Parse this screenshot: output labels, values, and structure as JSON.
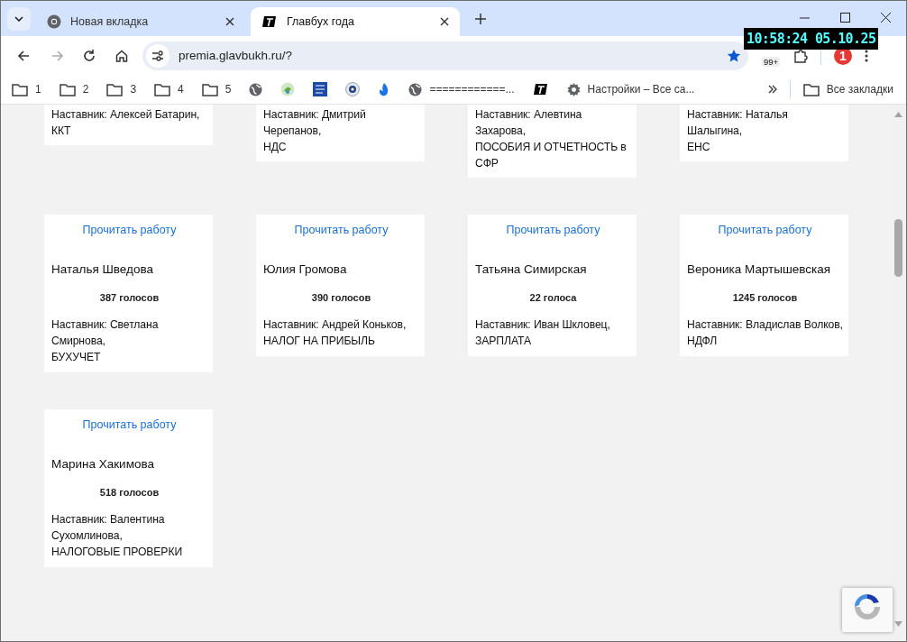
{
  "tabs": [
    {
      "title": "Новая вкладка",
      "kind": "chrome",
      "selected": false
    },
    {
      "title": "Главбух года",
      "kind": "logo",
      "selected": true
    }
  ],
  "address_bar": {
    "url": "premia.glavbukh.ru/?",
    "bookmarked": true
  },
  "clock": "10:58:24 05.10.25",
  "extensions": [
    {
      "kind": "badge",
      "label": "99+"
    },
    {
      "kind": "puzzle"
    },
    {
      "kind": "counter",
      "label": "1"
    }
  ],
  "bookmarks": [
    {
      "kind": "folder",
      "label": "1"
    },
    {
      "kind": "folder",
      "label": "2"
    },
    {
      "kind": "folder",
      "label": "3"
    },
    {
      "kind": "folder",
      "label": "4"
    },
    {
      "kind": "folder",
      "label": "5"
    },
    {
      "kind": "globe"
    },
    {
      "kind": "leaf"
    },
    {
      "kind": "weather"
    },
    {
      "kind": "seal"
    },
    {
      "kind": "flame"
    },
    {
      "kind": "globe",
      "label": "============..."
    },
    {
      "kind": "logo"
    },
    {
      "kind": "gear",
      "label": "Настройки – Все са..."
    }
  ],
  "all_bookmarks": "Все закладки",
  "cards": [
    {
      "mentor": "Наставник: Алексей Батарин,",
      "topic": "ККТ"
    },
    {
      "mentor": "Наставник: Дмитрий Черепанов,",
      "topic": "НДС"
    },
    {
      "mentor": "Наставник: Алевтина Захарова,",
      "topic": "ПОСОБИЯ И ОТЧЕТНОСТЬ в СФР"
    },
    {
      "mentor": "Наставник: Наталья Шалыгина,",
      "topic": "ЕНС"
    },
    {
      "link": "Прочитать работу",
      "name": "Наталья Шведова",
      "votes": "387 голосов",
      "mentor": "Наставник: Светлана Смирнова,",
      "topic": "БУХУЧЕТ"
    },
    {
      "link": "Прочитать работу",
      "name": "Юлия Громова",
      "votes": "390 голосов",
      "mentor": "Наставник: Андрей Коньков,",
      "topic": "НАЛОГ НА ПРИБЫЛЬ"
    },
    {
      "link": "Прочитать работу",
      "name": "Татьяна Симирская",
      "votes": "22 голоса",
      "mentor": "Наставник: Иван Шкловец,",
      "topic": "ЗАРПЛАТА"
    },
    {
      "link": "Прочитать работу",
      "name": "Вероника Мартышевская",
      "votes": "1245 голосов",
      "mentor": "Наставник: Владислав Волков,",
      "topic": "НДФЛ"
    },
    {
      "link": "Прочитать работу",
      "name": "Марина Хакимова",
      "votes": "518 голосов",
      "mentor": "Наставник: Валентина Сухомлинова,",
      "topic": "НАЛОГОВЫЕ ПРОВЕРКИ"
    }
  ]
}
